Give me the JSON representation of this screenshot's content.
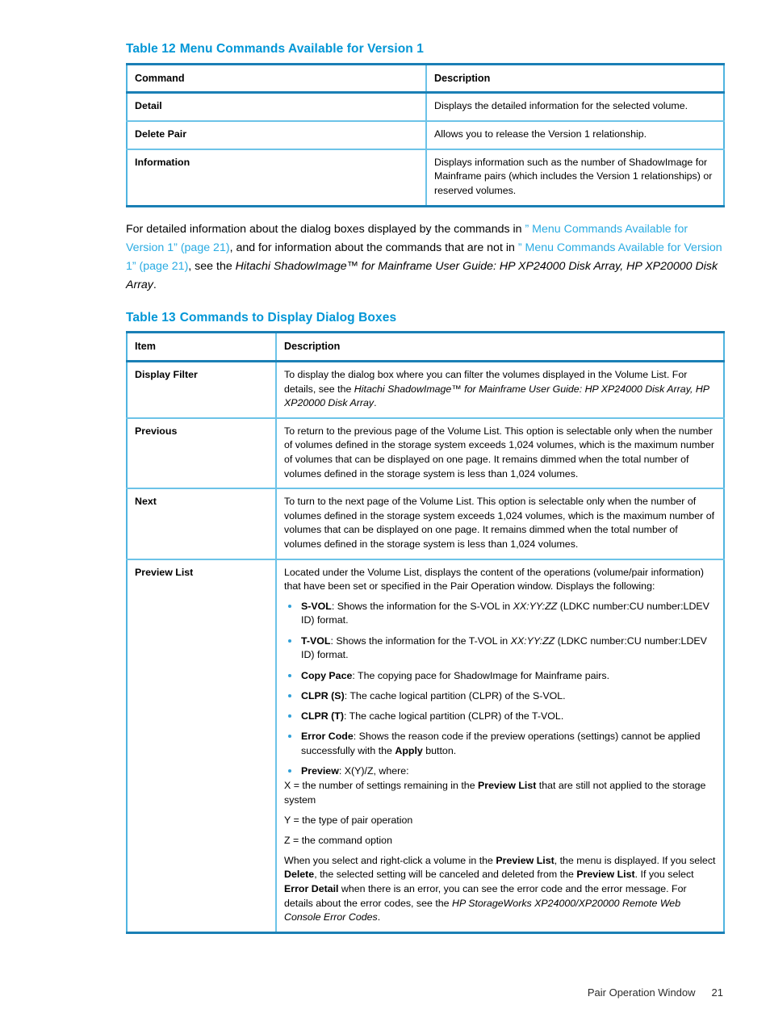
{
  "page": {
    "footer_title": "Pair Operation Window",
    "footer_page_number": "21"
  },
  "colors": {
    "heading_blue": "#0096d6",
    "link_blue": "#29abe2",
    "table_border_dark": "#1a7fb5",
    "table_border_light": "#6cc3e8",
    "bullet_blue": "#2f9fd8"
  },
  "table12": {
    "caption_number": "Table 12",
    "caption_title": "Menu Commands Available for Version 1",
    "headers": [
      "Command",
      "Description"
    ],
    "rows": [
      {
        "command": "Detail",
        "description": "Displays the detailed information for the selected volume."
      },
      {
        "command": "Delete Pair",
        "description": "Allows you to release the Version 1 relationship."
      },
      {
        "command": "Information",
        "description": "Displays information such as the number of ShadowImage for Mainframe pairs (which includes the Version 1 relationships) or reserved volumes."
      }
    ]
  },
  "paragraph": {
    "seg1": "For detailed information about the dialog boxes displayed by the commands in ",
    "link1": "” Menu Commands Available for Version 1” (page 21)",
    "seg2": ", and for information about the commands that are not in ",
    "link2": "” Menu Commands Available for Version 1” (page 21)",
    "seg3": ", see the ",
    "italic1": "Hitachi ShadowImage™ for Mainframe User Guide: HP XP24000 Disk Array, HP XP20000 Disk Array",
    "seg4": "."
  },
  "table13": {
    "caption_number": "Table 13",
    "caption_title": "Commands to Display Dialog Boxes",
    "headers": [
      "Item",
      "Description"
    ],
    "rows": [
      {
        "item": "Display Filter",
        "desc_p1_a": "To display the dialog box where you can filter the volumes displayed in the Volume List. For details, see the ",
        "desc_p1_italic": "Hitachi ShadowImage™ for Mainframe User Guide: HP XP24000 Disk Array, HP XP20000 Disk Array",
        "desc_p1_b": "."
      },
      {
        "item": "Previous",
        "desc_p1": "To return to the previous page of the Volume List. This option is selectable only when the number of volumes defined in the storage system exceeds 1,024 volumes, which is the maximum number of volumes that can be displayed on one page. It remains dimmed when the total number of volumes defined in the storage system is less than 1,024 volumes."
      },
      {
        "item": "Next",
        "desc_p1": "To turn to the next page of the Volume List. This option is selectable only when the number of volumes defined in the storage system exceeds 1,024 volumes, which is the maximum number of volumes that can be displayed on one page. It remains dimmed when the total number of volumes defined in the storage system is less than 1,024 volumes."
      },
      {
        "item": "Preview List",
        "intro": "Located under the Volume List, displays the content of the operations (volume/pair information) that have been set or specified in the Pair Operation window. Displays the following:",
        "bullets": [
          {
            "term": "S-VOL",
            "text_a": ": Shows the information for the S-VOL in ",
            "italic": "XX:YY:ZZ",
            "text_b": " (LDKC number:CU number:LDEV ID) format."
          },
          {
            "term": "T-VOL",
            "text_a": ": Shows the information for the T-VOL in ",
            "italic": "XX:YY:ZZ",
            "text_b": " (LDKC number:CU number:LDEV ID) format."
          },
          {
            "term": "Copy Pace",
            "text_a": ": The copying pace for ShadowImage for Mainframe pairs."
          },
          {
            "term": "CLPR (S)",
            "text_a": ": The cache logical partition (CLPR) of the S-VOL."
          },
          {
            "term": "CLPR (T)",
            "text_a": ": The cache logical partition (CLPR) of the T-VOL."
          },
          {
            "term": "Error Code",
            "text_a": ": Shows the reason code if the preview operations (settings) cannot be applied successfully with the ",
            "bold_inline": "Apply",
            "text_b": " button."
          },
          {
            "term": "Preview",
            "text_a": ": X(Y)/Z, where:"
          }
        ],
        "sub_x_a": "X = the number of settings remaining in the ",
        "sub_x_bold": "Preview List",
        "sub_x_b": " that are still not applied to the storage system",
        "sub_y": "Y = the type of pair operation",
        "sub_z": "Z = the command option",
        "closing_a": "When you select and right-click a volume in the ",
        "closing_bold1": "Preview List",
        "closing_b": ", the menu is displayed. If you select ",
        "closing_bold2": "Delete",
        "closing_c": ", the selected setting will be canceled and deleted from the ",
        "closing_bold3": "Preview List",
        "closing_d": ". If you select ",
        "closing_bold4": "Error Detail",
        "closing_e": " when there is an error, you can see the error code and the error message. For details about the error codes, see the ",
        "closing_italic": "HP StorageWorks XP24000/XP20000 Remote Web Console Error Codes",
        "closing_f": "."
      }
    ]
  }
}
